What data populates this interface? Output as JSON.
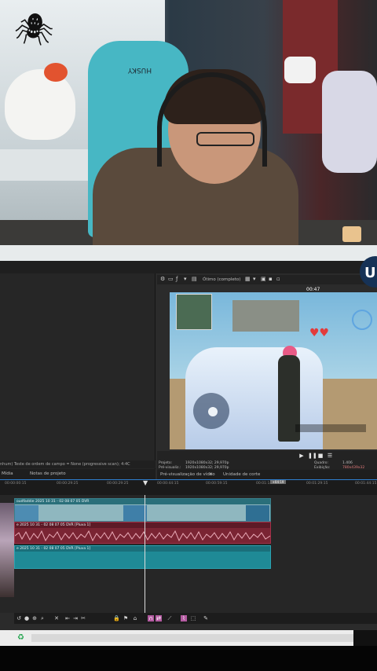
{
  "preview": {
    "quality_label": "Ótimo (completo)",
    "hud_time": "00:47"
  },
  "left_panel": {
    "status_text": "nhum) Teste de ordem de campo = None (progressive scan); 4:4C",
    "tabs": [
      "Mídia",
      "Notas de projeto"
    ]
  },
  "right_tabs": [
    "Pré-visualização de vídeo",
    "Unidade de corte"
  ],
  "info": {
    "project_label": "Projeto:",
    "project_value": "1920x1080x32; 29,970p",
    "preview_label": "Pré-visualiz.:",
    "preview_value": "1920x1080x32; 29,970p",
    "frame_label": "Quadro:",
    "frame_value": "1.406",
    "display_label": "Exibição:",
    "display_value": "780x439x32"
  },
  "timeline": {
    "ruler_ticks": [
      "00:00:00:15",
      "00:00:29:25",
      "00:00:29:25",
      "00:00:44:15",
      "00:00:59:15",
      "00:01:14:15",
      "00:01:29:15",
      "00:01:44:15"
    ],
    "loop_label": "+04:19",
    "tracks": [
      {
        "kind": "video",
        "label": "oudfaddie 2025 10 31 - 02 08 07 05 DVR"
      },
      {
        "kind": "audio",
        "label": "e 2025 10 31 - 02 08 07 05 DVR [Pluva 1]"
      },
      {
        "kind": "video",
        "label": "e 2025 10 31 - 02 08 07 05 DVR [Pluva 1]"
      }
    ]
  },
  "icons": {
    "brand": "brand-badge",
    "taskbar_app": "recycle-icon"
  },
  "colors": {
    "video_track": "#8fb7bf",
    "audio_track": "#7a2433",
    "accent_blue": "#2f7fd0",
    "active_tool": "#b35aa0"
  }
}
